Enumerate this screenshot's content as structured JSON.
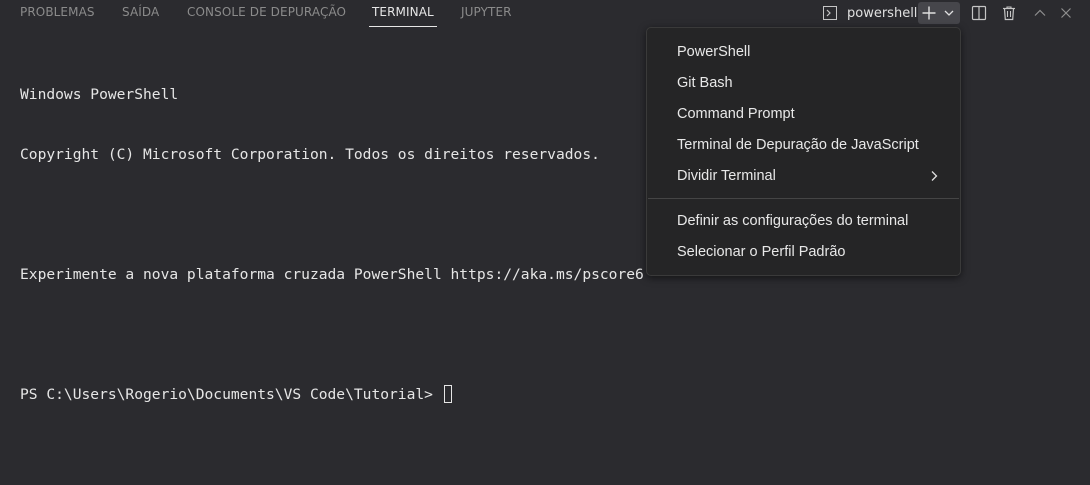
{
  "tabs": [
    {
      "label": "PROBLEMAS",
      "active": false
    },
    {
      "label": "SAÍDA",
      "active": false
    },
    {
      "label": "CONSOLE DE DEPURAÇÃO",
      "active": false
    },
    {
      "label": "TERMINAL",
      "active": true
    },
    {
      "label": "JUPYTER",
      "active": false
    }
  ],
  "toolbar": {
    "terminal_name": "powershell",
    "terminal_icon": "terminal-icon",
    "new_terminal_icon": "plus-icon",
    "dropdown_icon": "chevron-down-icon",
    "split_icon": "split-editor-icon",
    "kill_icon": "trash-icon",
    "maximize_icon": "chevron-up-icon",
    "close_icon": "close-icon"
  },
  "terminal": {
    "lines": [
      "Windows PowerShell",
      "Copyright (C) Microsoft Corporation. Todos os direitos reservados.",
      "",
      "Experimente a nova plataforma cruzada PowerShell https://aka.ms/pscore6",
      "",
      "PS C:\\Users\\Rogerio\\Documents\\VS Code\\Tutorial> "
    ]
  },
  "menu": {
    "items": [
      {
        "label": "PowerShell"
      },
      {
        "label": "Git Bash"
      },
      {
        "label": "Command Prompt"
      },
      {
        "label": "Terminal de Depuração de JavaScript"
      },
      {
        "label": "Dividir Terminal",
        "submenu": true
      }
    ],
    "settings_items": [
      {
        "label": "Definir as configurações do terminal"
      },
      {
        "label": "Selecionar o Perfil Padrão"
      }
    ]
  },
  "colors": {
    "background": "#2b2b2f",
    "active_tab": "#e7e7e7",
    "inactive_tab": "#8b8b8b",
    "menu_bg": "#252526"
  }
}
